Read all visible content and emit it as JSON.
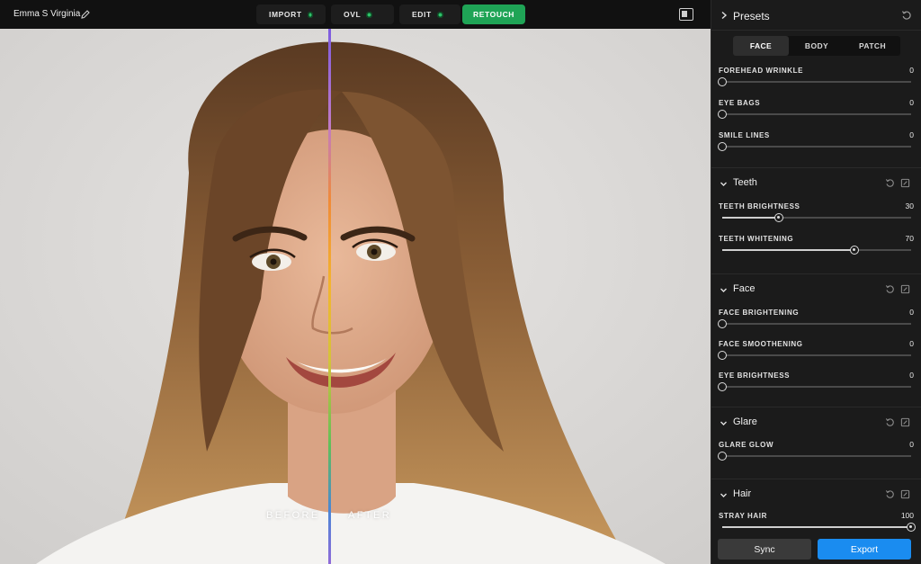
{
  "header": {
    "doc_title": "Emma S Virginia",
    "steps": [
      {
        "label": "IMPORT",
        "done": true
      },
      {
        "label": "OVL",
        "done": true
      },
      {
        "label": "EDIT",
        "done": true
      },
      {
        "label": "RETOUCH",
        "active": true
      }
    ]
  },
  "canvas": {
    "before_label": "BEFORE",
    "after_label": "AFTER"
  },
  "panel": {
    "title": "Presets",
    "tabs": [
      "FACE",
      "BODY",
      "PATCH"
    ],
    "active_tab": "FACE",
    "presets_sliders": [
      {
        "label": "FOREHEAD WRINKLE",
        "value": "0",
        "fraction": 0.0
      },
      {
        "label": "EYE BAGS",
        "value": "0",
        "fraction": 0.0
      },
      {
        "label": "SMILE LINES",
        "value": "0",
        "fraction": 0.0
      }
    ],
    "sections": [
      {
        "name": "Teeth",
        "sliders": [
          {
            "label": "TEETH BRIGHTNESS",
            "value": "30",
            "fraction": 0.3
          },
          {
            "label": "TEETH WHITENING",
            "value": "70",
            "fraction": 0.7
          }
        ]
      },
      {
        "name": "Face",
        "sliders": [
          {
            "label": "FACE BRIGHTENING",
            "value": "0",
            "fraction": 0.0
          },
          {
            "label": "FACE SMOOTHENING",
            "value": "0",
            "fraction": 0.0
          },
          {
            "label": "EYE BRIGHTNESS",
            "value": "0",
            "fraction": 0.0
          }
        ]
      },
      {
        "name": "Glare",
        "sliders": [
          {
            "label": "GLARE GLOW",
            "value": "0",
            "fraction": 0.0
          }
        ]
      },
      {
        "name": "Hair",
        "sliders": [
          {
            "label": "STRAY HAIR",
            "value": "100",
            "fraction": 1.0
          }
        ]
      }
    ],
    "sync_label": "Sync",
    "export_label": "Export"
  },
  "colors": {
    "accent_green": "#1fa456",
    "export_blue": "#1a8cf0",
    "panel_bg": "#1b1b1b"
  },
  "icons": [
    "pencil-icon",
    "compare-icon",
    "chevron-right-icon",
    "reset-icon",
    "chevron-down-icon",
    "copy-icon"
  ]
}
